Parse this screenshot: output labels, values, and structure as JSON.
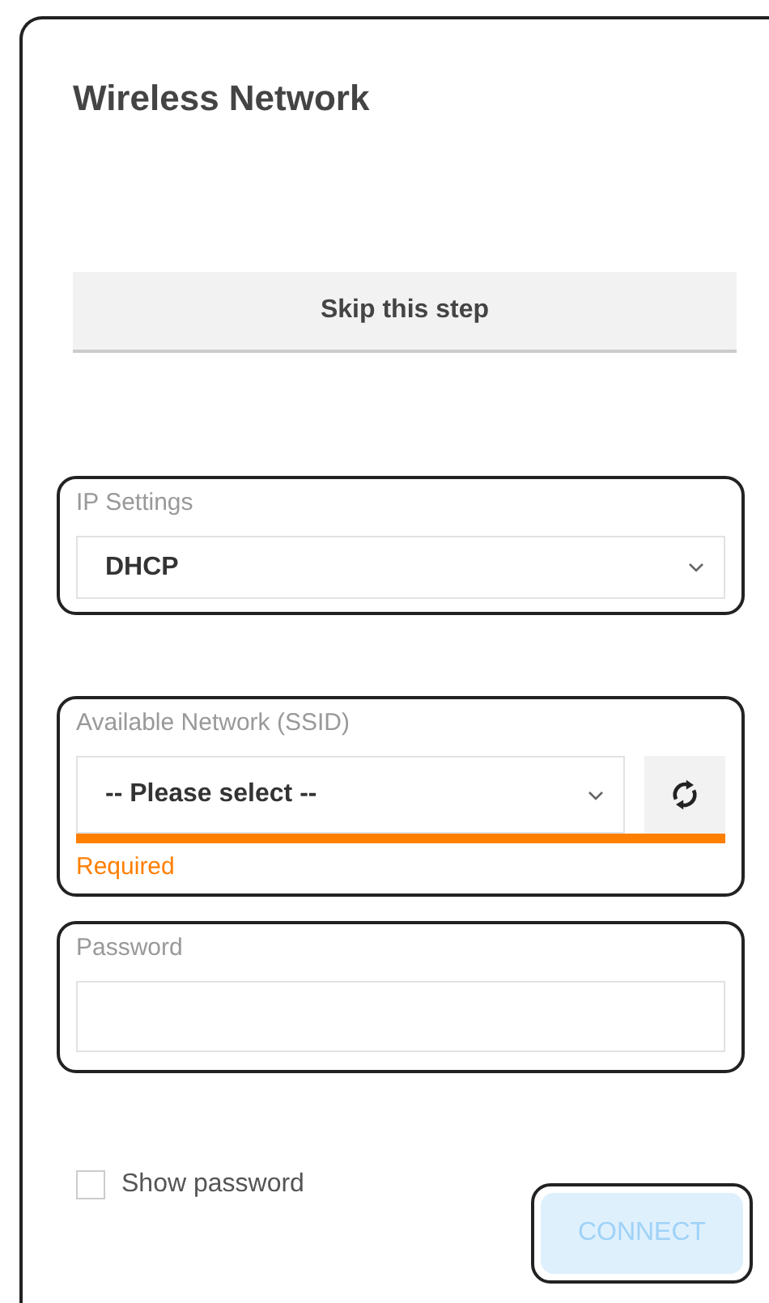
{
  "title": "Wireless Network",
  "skip_button": "Skip this step",
  "ip_settings": {
    "label": "IP Settings",
    "value": "DHCP"
  },
  "network": {
    "label": "Available Network (SSID)",
    "value": "-- Please select --",
    "error": true,
    "error_text": "Required"
  },
  "password": {
    "label": "Password"
  },
  "show_password": {
    "label": "Show password",
    "checked": false
  },
  "connect_button": {
    "label": "CONNECT",
    "disabled": true
  }
}
